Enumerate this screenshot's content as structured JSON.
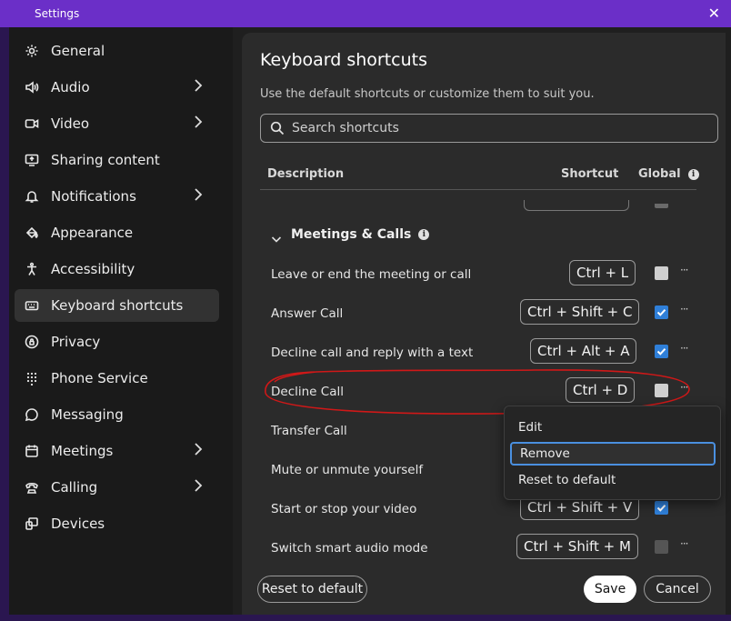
{
  "window": {
    "title": "Settings",
    "close_glyph": "✕"
  },
  "sidebar": {
    "items": [
      {
        "label": "General",
        "icon": "gear-icon",
        "chevron": false
      },
      {
        "label": "Audio",
        "icon": "speaker-icon",
        "chevron": true
      },
      {
        "label": "Video",
        "icon": "camera-icon",
        "chevron": true
      },
      {
        "label": "Sharing content",
        "icon": "share-screen-icon",
        "chevron": false
      },
      {
        "label": "Notifications",
        "icon": "bell-icon",
        "chevron": true
      },
      {
        "label": "Appearance",
        "icon": "paint-bucket-icon",
        "chevron": false
      },
      {
        "label": "Accessibility",
        "icon": "accessibility-icon",
        "chevron": false
      },
      {
        "label": "Keyboard shortcuts",
        "icon": "keyboard-icon",
        "chevron": false,
        "active": true
      },
      {
        "label": "Privacy",
        "icon": "privacy-icon",
        "chevron": false
      },
      {
        "label": "Phone Service",
        "icon": "dialpad-icon",
        "chevron": false
      },
      {
        "label": "Messaging",
        "icon": "chat-icon",
        "chevron": false
      },
      {
        "label": "Meetings",
        "icon": "calendar-icon",
        "chevron": true
      },
      {
        "label": "Calling",
        "icon": "phone-icon",
        "chevron": true
      },
      {
        "label": "Devices",
        "icon": "devices-icon",
        "chevron": false
      }
    ]
  },
  "panel": {
    "title": "Keyboard shortcuts",
    "subtitle": "Use the default shortcuts or customize them to suit you.",
    "search_placeholder": "Search shortcuts",
    "columns": {
      "description": "Description",
      "shortcut": "Shortcut",
      "global": "Global"
    },
    "group": {
      "label": "Meetings & Calls"
    },
    "rows": [
      {
        "description": "Leave or end the meeting or call",
        "shortcut": "Ctrl + L",
        "global": "unchecked"
      },
      {
        "description": "Answer Call",
        "shortcut": "Ctrl + Shift + C",
        "global": "checked"
      },
      {
        "description": "Decline call and reply with a text",
        "shortcut": "Ctrl + Alt + A",
        "global": "checked"
      },
      {
        "description": "Decline Call",
        "shortcut": "Ctrl + D",
        "global": "unchecked"
      },
      {
        "description": "Transfer Call",
        "shortcut": "",
        "global": "hidden"
      },
      {
        "description": "Mute or unmute yourself",
        "shortcut": "",
        "global": "hidden"
      },
      {
        "description": "Start or stop your video",
        "shortcut": "Ctrl + Shift + V",
        "global": "checked"
      },
      {
        "description": "Switch smart audio mode",
        "shortcut": "Ctrl + Shift + M",
        "global": "disabled"
      }
    ],
    "more_glyph": "···",
    "reset_label": "Reset to default",
    "save_label": "Save",
    "cancel_label": "Cancel"
  },
  "context_menu": {
    "items": [
      "Edit",
      "Remove",
      "Reset to default"
    ],
    "selected": "Remove"
  },
  "colors": {
    "titlebar": "#6b2fc8",
    "checkbox_on": "#2f7fd8",
    "annotation": "#d01818",
    "menu_focus": "#4a90e0"
  }
}
